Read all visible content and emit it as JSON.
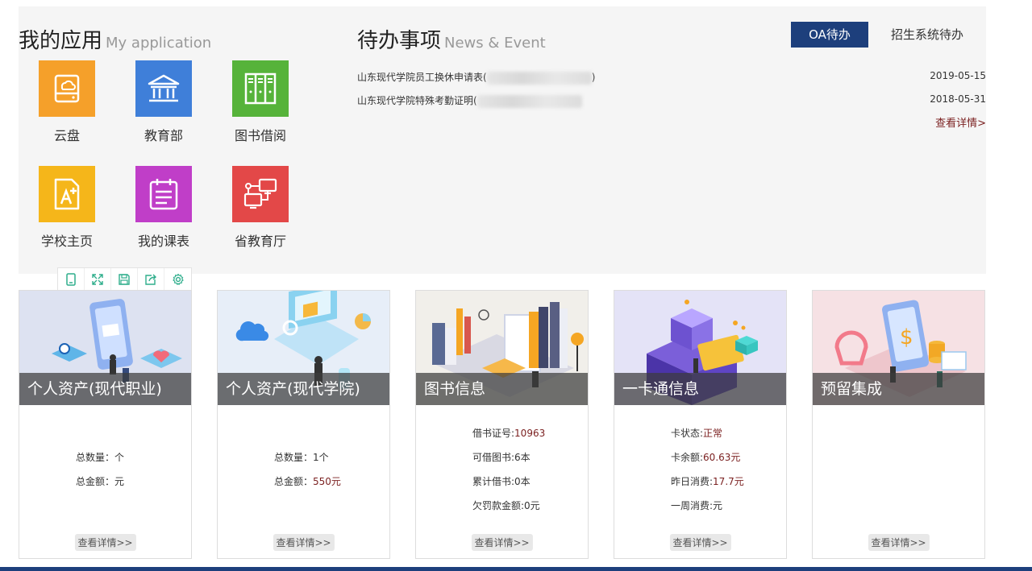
{
  "apps": {
    "title": "我的应用",
    "subtitle": "My application",
    "items": [
      {
        "label": "云盘",
        "icon": "cloud-disk-icon",
        "color": "#f5a02a"
      },
      {
        "label": "教育部",
        "icon": "ministry-building-icon",
        "color": "#3f7fd9"
      },
      {
        "label": "图书借阅",
        "icon": "bookshelf-icon",
        "color": "#56b33a"
      },
      {
        "label": "学校主页",
        "icon": "school-homepage-icon",
        "color": "#f5b61a"
      },
      {
        "label": "我的课表",
        "icon": "schedule-icon",
        "color": "#c03ec8"
      },
      {
        "label": "省教育厅",
        "icon": "network-office-icon",
        "color": "#e34848"
      }
    ]
  },
  "news": {
    "title": "待办事项",
    "subtitle": "News & Event",
    "tabs": [
      "OA待办",
      "招生系统待办"
    ],
    "items": [
      {
        "title": "山东现代学院员工换休申请表(",
        "suffix": ")",
        "date": "2019-05-15"
      },
      {
        "title": "山东现代学院特殊考勤证明(",
        "suffix": "",
        "date": "2018-05-31"
      }
    ],
    "more": "查看详情>"
  },
  "toolbar": {
    "icons": [
      "tablet-icon",
      "fullscreen-icon",
      "save-icon",
      "share-icon",
      "settings-icon"
    ]
  },
  "cards": [
    {
      "caption": "个人资产(现代职业)",
      "rows": [
        {
          "label": "总数量：",
          "value": "个"
        },
        {
          "label": "总金额：",
          "value": "元"
        }
      ],
      "button": "查看详情>>"
    },
    {
      "caption": "个人资产(现代学院)",
      "rows": [
        {
          "label": "总数量：",
          "value": "1个"
        },
        {
          "label": "总金额：",
          "value": "550元"
        }
      ],
      "button": "查看详情>>"
    },
    {
      "caption": "图书信息",
      "rows": [
        {
          "label": "借书证号:",
          "value": "10963"
        },
        {
          "label": "可借图书:",
          "value": "6本"
        },
        {
          "label": "累计借书:",
          "value": "0本"
        },
        {
          "label": "欠罚款金额:",
          "value": "0元"
        }
      ],
      "button": "查看详情>>"
    },
    {
      "caption": "一卡通信息",
      "rows": [
        {
          "label": "卡状态:",
          "value": "正常"
        },
        {
          "label": "卡余额:",
          "value": "60.63元"
        },
        {
          "label": "昨日消费:",
          "value": "17.7元"
        },
        {
          "label": "一周消费:",
          "value": "元"
        }
      ],
      "button": "查看详情>>"
    },
    {
      "caption": "预留集成",
      "rows": [],
      "button": "查看详情>>"
    }
  ],
  "colors": {
    "primary": "#1d3f7c",
    "accent_text": "#7a1f1f",
    "panel_bg": "#f5f5f5",
    "toolbar_icon": "#2fae8c"
  }
}
